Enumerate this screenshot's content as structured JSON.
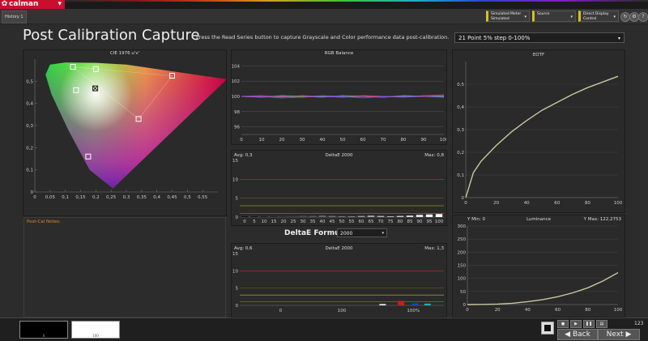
{
  "app": {
    "name": "calman",
    "tab": "History 1"
  },
  "header_dropdowns": [
    {
      "line1": "Simulated Meter",
      "line2": "Simulated"
    },
    {
      "line1": "Source",
      "line2": ""
    },
    {
      "line1": "Direct Display Control",
      "line2": ""
    }
  ],
  "header_icons": [
    "refresh-icon",
    "settings-icon",
    "help-icon"
  ],
  "page": {
    "title": "Post Calibration Capture",
    "instruction": "Press the Read Series button to capture Grayscale and Color performance data post-calibration.",
    "series_select": "21 Point 5% step 0-100%"
  },
  "notes": {
    "label": "Post-Cal Notes:"
  },
  "formula": {
    "label": "DeltaE Formula",
    "value": "2000"
  },
  "bottom": {
    "swatch1_label": "0",
    "swatch2_label": "100",
    "back_label": "Back",
    "next_label": "Next",
    "page_number": "123"
  },
  "colors": {
    "accent": "#c8102e",
    "yellow_tag": "#d8c020",
    "curve": "#c8c8a0",
    "notes_label": "#e08a2a"
  },
  "chart_data": [
    {
      "type": "scatter",
      "title": "CIE 1976 u'v'",
      "xticks": [
        "0",
        "0,05",
        "0,1",
        "0,15",
        "0,2",
        "0,25",
        "0,3",
        "0,35",
        "0,4",
        "0,45",
        "0,5",
        "0,55"
      ],
      "yticks": [
        "0",
        "0,1",
        "0,2",
        "0,3",
        "0,4",
        "0,5"
      ],
      "xlim": [
        0,
        0.6
      ],
      "ylim": [
        0,
        0.6
      ],
      "points": [
        {
          "u": 0.125,
          "v": 0.565,
          "kind": "target"
        },
        {
          "u": 0.2,
          "v": 0.555,
          "kind": "target"
        },
        {
          "u": 0.45,
          "v": 0.525,
          "kind": "target"
        },
        {
          "u": 0.135,
          "v": 0.46,
          "kind": "target"
        },
        {
          "u": 0.198,
          "v": 0.468,
          "kind": "white"
        },
        {
          "u": 0.34,
          "v": 0.33,
          "kind": "target"
        },
        {
          "u": 0.175,
          "v": 0.16,
          "kind": "target"
        }
      ]
    },
    {
      "type": "line",
      "title": "RGB Balance",
      "x": [
        0,
        10,
        20,
        30,
        40,
        50,
        60,
        70,
        80,
        90,
        100
      ],
      "ylim": [
        95,
        105
      ],
      "yticks": [
        "96",
        "98",
        "100",
        "102",
        "104"
      ],
      "series": [
        {
          "color": "#e04040",
          "values": [
            100,
            100.1,
            99.9,
            100.1,
            100,
            99.9,
            100.1,
            100,
            99.9,
            100.1,
            100.2
          ]
        },
        {
          "color": "#40c040",
          "values": [
            100,
            99.9,
            100.1,
            100,
            99.9,
            100.1,
            100,
            99.9,
            100.1,
            100,
            99.9
          ]
        },
        {
          "color": "#4060ff",
          "values": [
            100,
            100,
            99.8,
            99.9,
            100.1,
            100,
            99.8,
            100,
            99.9,
            100,
            100.1
          ]
        },
        {
          "color": "#b050d0",
          "values": [
            100,
            99.9,
            100,
            99.9,
            100,
            99.9,
            100,
            99.9,
            100,
            100,
            100
          ]
        }
      ]
    },
    {
      "type": "bar",
      "title": "DeltaE 2000",
      "avg": "Avg: 0,3",
      "max": "Max: 0,8",
      "categories": [
        "0",
        "5",
        "10",
        "15",
        "20",
        "25",
        "30",
        "35",
        "40",
        "45",
        "50",
        "55",
        "60",
        "65",
        "70",
        "75",
        "80",
        "85",
        "90",
        "95",
        "100"
      ],
      "values": [
        0,
        0,
        0.1,
        0.1,
        0.2,
        0.2,
        0.3,
        0.3,
        0.4,
        0.3,
        0.2,
        0.2,
        0.3,
        0.4,
        0.3,
        0.2,
        0.3,
        0.4,
        0.6,
        0.7,
        0.8
      ],
      "ylim": [
        0,
        15
      ],
      "yticks": [
        "0",
        "5",
        "10",
        "15"
      ]
    },
    {
      "type": "line",
      "title": "EOTF",
      "x": [
        0,
        5,
        10,
        20,
        30,
        40,
        50,
        60,
        70,
        80,
        90,
        100
      ],
      "values": [
        0,
        0.11,
        0.16,
        0.23,
        0.29,
        0.34,
        0.385,
        0.42,
        0.455,
        0.485,
        0.51,
        0.535
      ],
      "xlim": [
        0,
        100
      ],
      "ylim": [
        0,
        0.6
      ],
      "xticks": [
        "0",
        "20",
        "40",
        "60",
        "80",
        "100"
      ],
      "yticks": [
        "0",
        "0,1",
        "0,2",
        "0,3",
        "0,4",
        "0,5"
      ]
    },
    {
      "type": "bar",
      "title": "DeltaE 2000",
      "avg": "Avg: 0,6",
      "max": "Max: 1,3",
      "x_ticks": [
        "0",
        "100",
        "100%"
      ],
      "bars": [
        {
          "pos": 0.7,
          "value": 0.4,
          "color": "#e8e8e8"
        },
        {
          "pos": 0.79,
          "value": 1.3,
          "color": "#c02020"
        },
        {
          "pos": 0.86,
          "value": 0.6,
          "color": "#2040c0"
        },
        {
          "pos": 0.92,
          "value": 0.5,
          "color": "#20b0b0"
        }
      ],
      "ylim": [
        0,
        15
      ],
      "yticks": [
        "0",
        "5",
        "10",
        "15"
      ]
    },
    {
      "type": "line",
      "title": "Luminance",
      "ymin_label": "Y Min: 0",
      "ymax_label": "Y Max: 122,2753",
      "x": [
        0,
        10,
        20,
        30,
        40,
        50,
        60,
        70,
        80,
        90,
        100
      ],
      "values": [
        0,
        0.5,
        2,
        5,
        11,
        19,
        30,
        45,
        64,
        90,
        122
      ],
      "xlim": [
        0,
        100
      ],
      "ylim": [
        0,
        300
      ],
      "xticks": [
        "0",
        "20",
        "40",
        "60",
        "80",
        "100"
      ],
      "yticks": [
        "0",
        "50",
        "100",
        "150",
        "200",
        "250",
        "300"
      ]
    }
  ]
}
